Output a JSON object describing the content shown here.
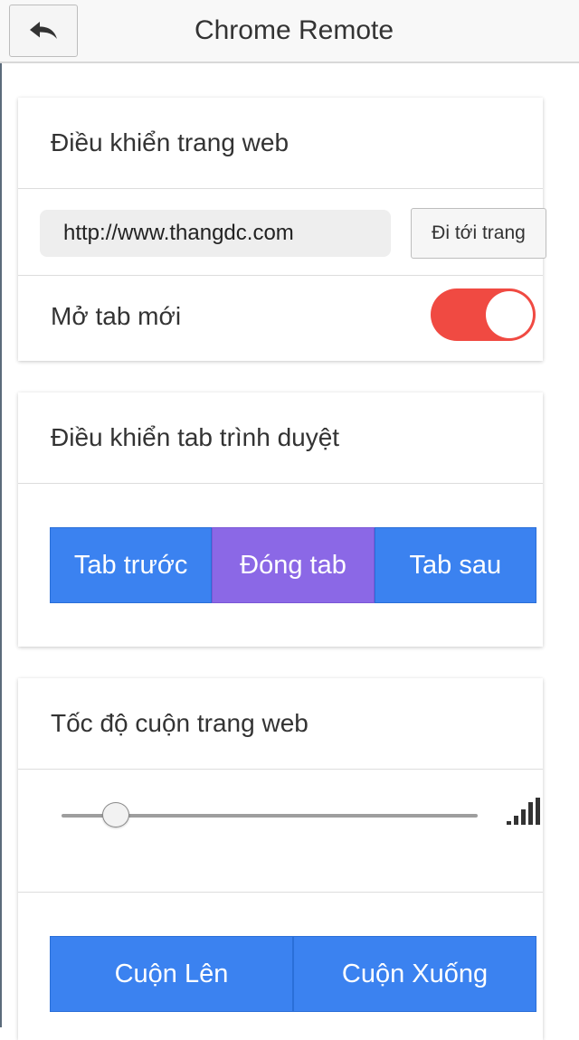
{
  "header": {
    "title": "Chrome Remote",
    "back_icon": "back-arrow-icon"
  },
  "web_control": {
    "title": "Điều khiển trang web",
    "url_value": "http://www.thangdc.com",
    "go_label": "Đi tới trang",
    "new_tab_label": "Mở tab mới",
    "new_tab_enabled": true,
    "toggle_color": "#f04a42"
  },
  "tab_control": {
    "title": "Điều khiển tab trình duyệt",
    "buttons": [
      {
        "label": "Tab trước",
        "active": false
      },
      {
        "label": "Đóng tab",
        "active": true
      },
      {
        "label": "Tab sau",
        "active": false
      }
    ]
  },
  "scroll_control": {
    "title": "Tốc độ cuộn trang web",
    "speed_level": 0.12,
    "speed_icon": "signal-strength-icon",
    "scroll_up_label": "Cuộn Lên",
    "scroll_down_label": "Cuộn Xuống"
  },
  "colors": {
    "primary": "#3b82f0",
    "active": "#8b68e6",
    "toggle_on": "#f04a42"
  }
}
